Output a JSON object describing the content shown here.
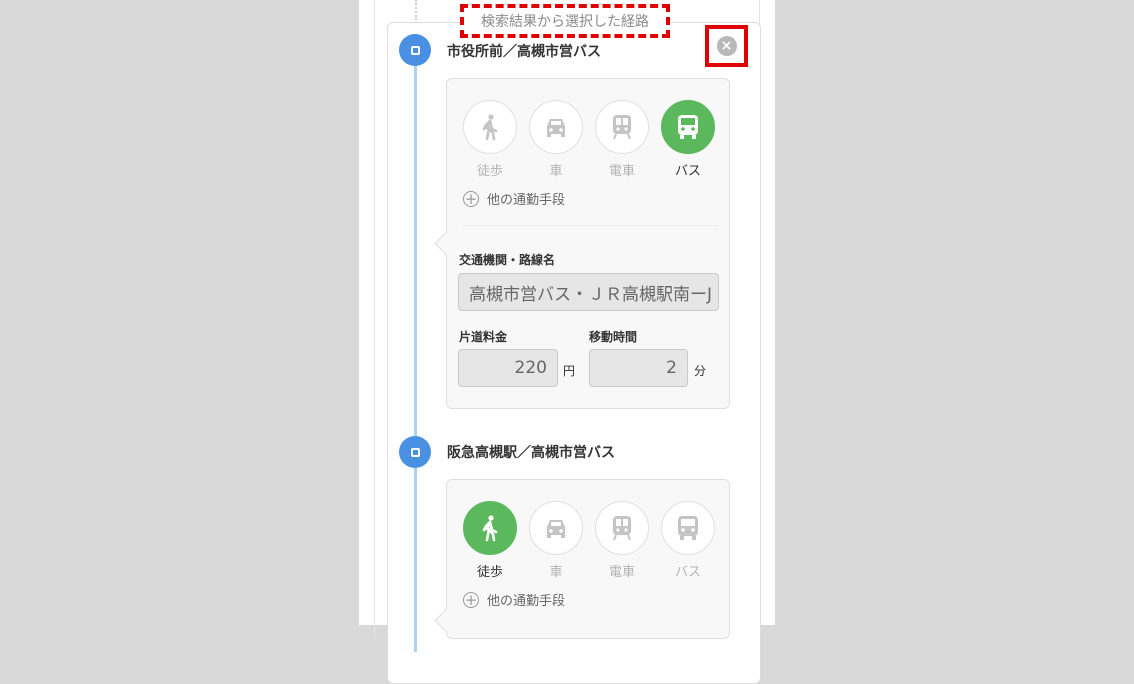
{
  "legend": {
    "title": "検索結果から選択した経路"
  },
  "stops": [
    {
      "name": "市役所前／高槻市営バス",
      "modes": [
        {
          "label": "徒歩",
          "icon": "walk-icon",
          "active": false
        },
        {
          "label": "車",
          "icon": "car-icon",
          "active": false
        },
        {
          "label": "電車",
          "icon": "train-icon",
          "active": false
        },
        {
          "label": "バス",
          "icon": "bus-icon",
          "active": true
        }
      ],
      "other_label": "他の通勤手段",
      "route_label": "交通機関・路線名",
      "route_value": "高槻市営バス・ＪＲ高槻駅南ーJ",
      "fare_label": "片道料金",
      "fare_value": "220",
      "fare_unit": "円",
      "time_label": "移動時間",
      "time_value": "2",
      "time_unit": "分"
    },
    {
      "name": "阪急高槻駅／高槻市営バス",
      "modes": [
        {
          "label": "徒歩",
          "icon": "walk-icon",
          "active": true
        },
        {
          "label": "車",
          "icon": "car-icon",
          "active": false
        },
        {
          "label": "電車",
          "icon": "train-icon",
          "active": false
        },
        {
          "label": "バス",
          "icon": "bus-icon",
          "active": false
        }
      ],
      "other_label": "他の通勤手段"
    }
  ],
  "colors": {
    "accent": "#4a90e2",
    "active_mode": "#5cb85c",
    "highlight": "#e00000",
    "timeline": "#a9d3f2"
  }
}
